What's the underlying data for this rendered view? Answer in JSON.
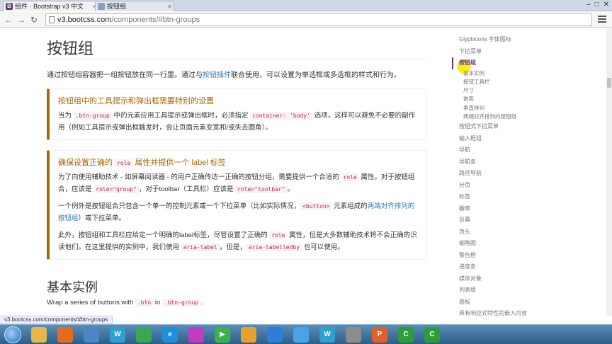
{
  "browser": {
    "tabs": [
      {
        "title": "组件 · Bootstrap v3 中文",
        "favicon": "B",
        "color": "#563d7c",
        "active": true
      },
      {
        "title": "按钮组",
        "favicon": "",
        "color": "#8aa0b8",
        "active": false
      }
    ],
    "url": {
      "host": "v3.bootcss.com",
      "path": "/components/#btn-groups"
    }
  },
  "page": {
    "title": "按钮组",
    "lead_pre": "通过按钮组容器把一组按钮放在同一行里。通过与",
    "lead_link": "按钮插件",
    "lead_post": "联合使用，可以设置为单选框或多选框的样式和行为。",
    "callout1": {
      "heading": "按钮组中的工具提示和弹出框需要特别的设置",
      "p1_pre": "当为 ",
      "p1_code1": ".btn-group",
      "p1_mid": " 中的元素应用工具提示或弹出框时，必须指定 ",
      "p1_code2": "container: 'body'",
      "p1_post": " 选项，这样可以避免不必要的副作用（例如工具提示或弹出框触发时，会让页面元素变宽和/或失去圆角）。"
    },
    "callout2": {
      "heading_pre": "确保设置正确的 ",
      "heading_code": "role",
      "heading_post": " 属性并提供一个 label 标签",
      "p1_a": "为了向使用辅助技术 - 如屏幕阅读器 - 的用户正确传达一正确的按钮分组，需要提供一个合适的 ",
      "p1_code1": "role",
      "p1_b": " 属性。对于按钮组合，应该是 ",
      "p1_code2": "role=\"group\"",
      "p1_c": "，对于toolbar（工具栏）应该是 ",
      "p1_code3": "role=\"toolbar\"",
      "p1_d": "。",
      "p2_a": "一个例外是按钮组合只包含一个单一的控制元素或一个下拉菜单（比如实际情况，",
      "p2_code": "<button>",
      "p2_b": " 元素组成的",
      "p2_link": "两端对齐排列的按钮组",
      "p2_c": "）或下拉菜单。",
      "p3_a": "此外，按钮组和工具栏应给定一个明确的label标签，尽管设置了正确的 ",
      "p3_code1": "role",
      "p3_b": " 属性，但是大多数辅助技术将不会正确的识读他们。在这里提供的实例中，我们使用 ",
      "p3_code2": "aria-label",
      "p3_c": "，但是，",
      "p3_code3": "aria-labelledby",
      "p3_d": " 也可以使用。"
    },
    "section_title": "基本实例",
    "section_text_a": "Wrap a series of buttons with ",
    "section_code1": ".btn",
    "section_text_b": " in ",
    "section_code2": ".btn-group",
    "section_text_c": "."
  },
  "sidebar": {
    "top": [
      "Glyphicons 字体图标",
      "下拉菜单"
    ],
    "active": "按钮组",
    "sub": [
      "基本实例",
      "按钮工具栏",
      "尺寸",
      "嵌套",
      "垂直排列",
      "两端对齐排列的按钮组"
    ],
    "rest": [
      "按钮式下拉菜单",
      "输入框组",
      "导航",
      "导航条",
      "路径导航",
      "分页",
      "标签",
      "徽章",
      "巨幕",
      "页头",
      "缩略图",
      "警告框",
      "进度条",
      "媒体对象",
      "列表组",
      "面板",
      "具有响应式特性的嵌入内容"
    ]
  },
  "status_url": "v3.bootcss.com/components/#btn-groups",
  "taskbar": {
    "apps": [
      {
        "icon": "ie-folder-icon",
        "color": "#e6b84a",
        "label": ""
      },
      {
        "icon": "firefox-icon",
        "color": "#e66b1f",
        "label": ""
      },
      {
        "icon": "app-icon",
        "color": "#4a86c5",
        "label": ""
      },
      {
        "icon": "ws-icon",
        "color": "#2f9ed1",
        "label": "W"
      },
      {
        "icon": "chrome-icon",
        "color": "#3aa757",
        "label": ""
      },
      {
        "icon": "ie-icon",
        "color": "#1e8fd8",
        "label": "e"
      },
      {
        "icon": "picasa-icon",
        "color": "#c43bbf",
        "label": ""
      },
      {
        "icon": "media-player-icon",
        "color": "#3bb149",
        "label": "▶"
      },
      {
        "icon": "mail-icon",
        "color": "#e8a12b",
        "label": ""
      },
      {
        "icon": "notes-icon",
        "color": "#2e7dd6",
        "label": ""
      },
      {
        "icon": "cloud-icon",
        "color": "#4aa3e8",
        "label": ""
      },
      {
        "icon": "ws-icon-2",
        "color": "#2f9ed1",
        "label": "W"
      },
      {
        "icon": "drive-icon",
        "color": "#8c8c8c",
        "label": ""
      },
      {
        "icon": "ppt-icon",
        "color": "#e1602a",
        "label": "P"
      },
      {
        "icon": "camtasia-icon",
        "color": "#2c9d3a",
        "label": "C"
      },
      {
        "icon": "camtasia-icon-2",
        "color": "#2c9d3a",
        "label": "C"
      }
    ]
  }
}
